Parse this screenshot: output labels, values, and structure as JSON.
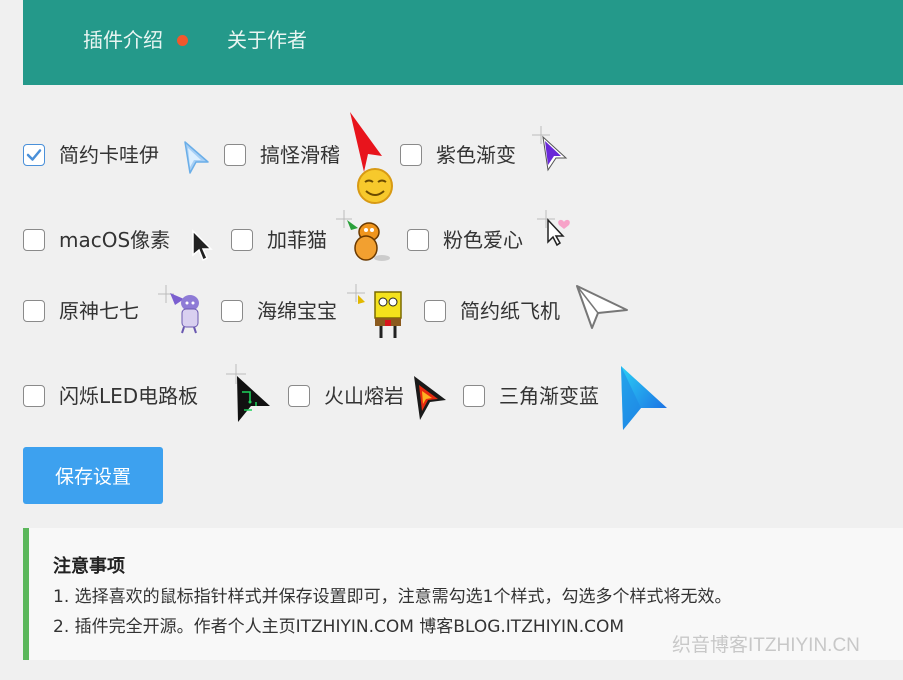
{
  "header": {
    "tabs": [
      {
        "label": "插件介绍",
        "active": true
      },
      {
        "label": "关于作者",
        "active": false
      }
    ],
    "background": "#24998a",
    "badge_color": "#f0582c"
  },
  "cursor_options": [
    {
      "label": "简约卡哇伊",
      "checked": true,
      "icon": "soft-blue-arrow-icon"
    },
    {
      "label": "搞怪滑稽",
      "checked": false,
      "icon": "red-arrow-smiley-icon"
    },
    {
      "label": "紫色渐变",
      "checked": false,
      "icon": "purple-gradient-arrow-icon"
    },
    {
      "label": "macOS像素",
      "checked": false,
      "icon": "macos-pixel-arrow-icon"
    },
    {
      "label": "加菲猫",
      "checked": false,
      "icon": "garfield-cursor-icon"
    },
    {
      "label": "粉色爱心",
      "checked": false,
      "icon": "pink-heart-arrow-icon"
    },
    {
      "label": "原神七七",
      "checked": false,
      "icon": "genshin-qiqi-cursor-icon"
    },
    {
      "label": "海绵宝宝",
      "checked": false,
      "icon": "spongebob-cursor-icon"
    },
    {
      "label": "简约纸飞机",
      "checked": false,
      "icon": "paper-plane-cursor-icon"
    },
    {
      "label": "闪烁LED电路板",
      "checked": false,
      "icon": "led-circuit-arrow-icon"
    },
    {
      "label": "火山熔岩",
      "checked": false,
      "icon": "lava-arrow-icon"
    },
    {
      "label": "三角渐变蓝",
      "checked": false,
      "icon": "blue-triangle-arrow-icon"
    }
  ],
  "save_button": {
    "label": "保存设置",
    "color": "#3da1ef"
  },
  "notice": {
    "title": "注意事项",
    "lines": [
      "1. 选择喜欢的鼠标指针样式并保存设置即可，注意需勾选1个样式，勾选多个样式将无效。",
      "2. 插件完全开源。作者个人主页ITZHIYIN.COM 博客BLOG.ITZHIYIN.COM"
    ],
    "accent_color": "#5bb75b"
  },
  "watermark": "织音博客ITZHIYIN.CN"
}
